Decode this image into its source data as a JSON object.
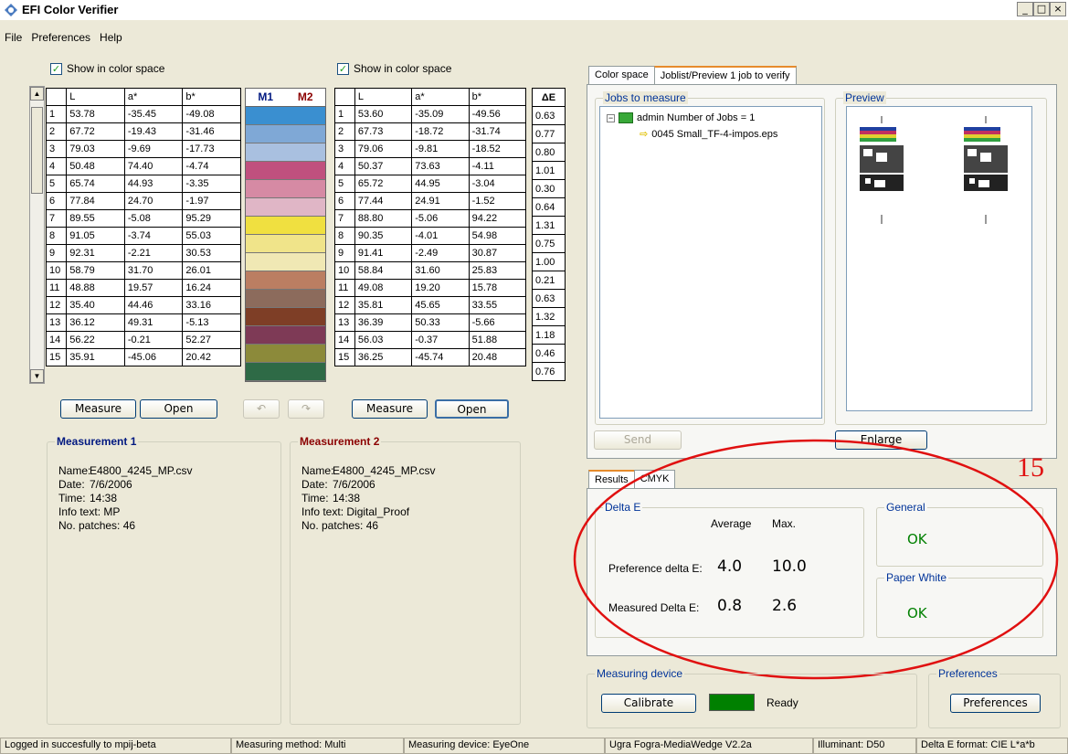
{
  "window": {
    "title": "EFI Color Verifier",
    "min": "_",
    "max": "□",
    "close": "×"
  },
  "menu": [
    "File",
    "Preferences",
    "Help"
  ],
  "left": {
    "show_label": "Show in color space",
    "headers": [
      "",
      "L",
      "a*",
      "b*"
    ],
    "rows": [
      [
        "1",
        "53.78",
        "-35.45",
        "-49.08"
      ],
      [
        "2",
        "67.72",
        "-19.43",
        "-31.46"
      ],
      [
        "3",
        "79.03",
        "-9.69",
        "-17.73"
      ],
      [
        "4",
        "50.48",
        "74.40",
        "-4.74"
      ],
      [
        "5",
        "65.74",
        "44.93",
        "-3.35"
      ],
      [
        "6",
        "77.84",
        "24.70",
        "-1.97"
      ],
      [
        "7",
        "89.55",
        "-5.08",
        "95.29"
      ],
      [
        "8",
        "91.05",
        "-3.74",
        "55.03"
      ],
      [
        "9",
        "92.31",
        "-2.21",
        "30.53"
      ],
      [
        "10",
        "58.79",
        "31.70",
        "26.01"
      ],
      [
        "11",
        "48.88",
        "19.57",
        "16.24"
      ],
      [
        "12",
        "35.40",
        "44.46",
        "33.16"
      ],
      [
        "13",
        "36.12",
        "49.31",
        "-5.13"
      ],
      [
        "14",
        "56.22",
        "-0.21",
        "52.27"
      ],
      [
        "15",
        "35.91",
        "-45.06",
        "20.42"
      ]
    ],
    "measure": "Measure",
    "open": "Open"
  },
  "swatches": {
    "m1": "M1",
    "m2": "M2",
    "colors": [
      "#3a8fd0",
      "#7fa8d6",
      "#a9c0e0",
      "#c0507e",
      "#d68aa4",
      "#e0b6c6",
      "#f0e040",
      "#f0e48a",
      "#f0e8b4",
      "#bb7e62",
      "#8c6b5c",
      "#7e3e26",
      "#7e3a56",
      "#8c8a3a",
      "#2e6a46"
    ]
  },
  "right": {
    "show_label": "Show in color space",
    "headers": [
      "",
      "L",
      "a*",
      "b*"
    ],
    "rows": [
      [
        "1",
        "53.60",
        "-35.09",
        "-49.56"
      ],
      [
        "2",
        "67.73",
        "-18.72",
        "-31.74"
      ],
      [
        "3",
        "79.06",
        "-9.81",
        "-18.52"
      ],
      [
        "4",
        "50.37",
        "73.63",
        "-4.11"
      ],
      [
        "5",
        "65.72",
        "44.95",
        "-3.04"
      ],
      [
        "6",
        "77.44",
        "24.91",
        "-1.52"
      ],
      [
        "7",
        "88.80",
        "-5.06",
        "94.22"
      ],
      [
        "8",
        "90.35",
        "-4.01",
        "54.98"
      ],
      [
        "9",
        "91.41",
        "-2.49",
        "30.87"
      ],
      [
        "10",
        "58.84",
        "31.60",
        "25.83"
      ],
      [
        "11",
        "49.08",
        "19.20",
        "15.78"
      ],
      [
        "12",
        "35.81",
        "45.65",
        "33.55"
      ],
      [
        "13",
        "36.39",
        "50.33",
        "-5.66"
      ],
      [
        "14",
        "56.03",
        "-0.37",
        "51.88"
      ],
      [
        "15",
        "36.25",
        "-45.74",
        "20.48"
      ]
    ],
    "measure": "Measure",
    "open": "Open"
  },
  "delta": {
    "header": "ΔE",
    "values": [
      "0.63",
      "0.77",
      "0.80",
      "1.01",
      "0.30",
      "0.64",
      "1.31",
      "0.75",
      "1.00",
      "0.21",
      "0.63",
      "1.32",
      "1.18",
      "0.46",
      "0.76"
    ]
  },
  "undo": "↶",
  "redo": "↷",
  "m1": {
    "title": "Measurement 1",
    "name_l": "Name:",
    "name": "E4800_4245_MP.csv",
    "date_l": "Date:",
    "date": "7/6/2006",
    "time_l": "Time:",
    "time": "14:38",
    "info_l": "Info text:",
    "info": "MP",
    "patches_l": "No. patches:",
    "patches": "46"
  },
  "m2": {
    "title": "Measurement 2",
    "name_l": "Name:",
    "name": "E4800_4245_MP.csv",
    "date_l": "Date:",
    "date": "7/6/2006",
    "time_l": "Time:",
    "time": "14:38",
    "info_l": "Info text:",
    "info": "Digital_Proof",
    "patches_l": "No. patches:",
    "patches": "46"
  },
  "tabs_top": [
    "Color space",
    "Joblist/Preview 1 job to verify"
  ],
  "jobs": {
    "legend": "Jobs to measure",
    "admin": "admin  Number of Jobs = 1",
    "job": "0045 Small_TF-4-impos.eps"
  },
  "preview": {
    "legend": "Preview"
  },
  "send": "Send",
  "enlarge": "Enlarge",
  "annotation": "15",
  "tabs_results": [
    "Results",
    "CMYK"
  ],
  "results": {
    "delta_legend": "Delta E",
    "avg": "Average",
    "max": "Max.",
    "pref_label": "Preference delta E:",
    "pref_avg": "4.0",
    "pref_max": "10.0",
    "meas_label": "Measured  Delta E:",
    "meas_avg": "0.8",
    "meas_max": "2.6",
    "general_legend": "General",
    "general_ok": "OK",
    "paper_legend": "Paper White",
    "paper_ok": "OK"
  },
  "device": {
    "legend": "Measuring device",
    "calibrate": "Calibrate",
    "ready": "Ready",
    "indicator_color": "#008000"
  },
  "prefs": {
    "legend": "Preferences",
    "button": "Preferences"
  },
  "status": [
    "Logged in succesfully to mpij-beta",
    "Measuring method: Multi",
    "Measuring device: EyeOne",
    "Ugra Fogra-MediaWedge V2.2a",
    "Illuminant: D50",
    "Delta E format: CIE L*a*b"
  ]
}
